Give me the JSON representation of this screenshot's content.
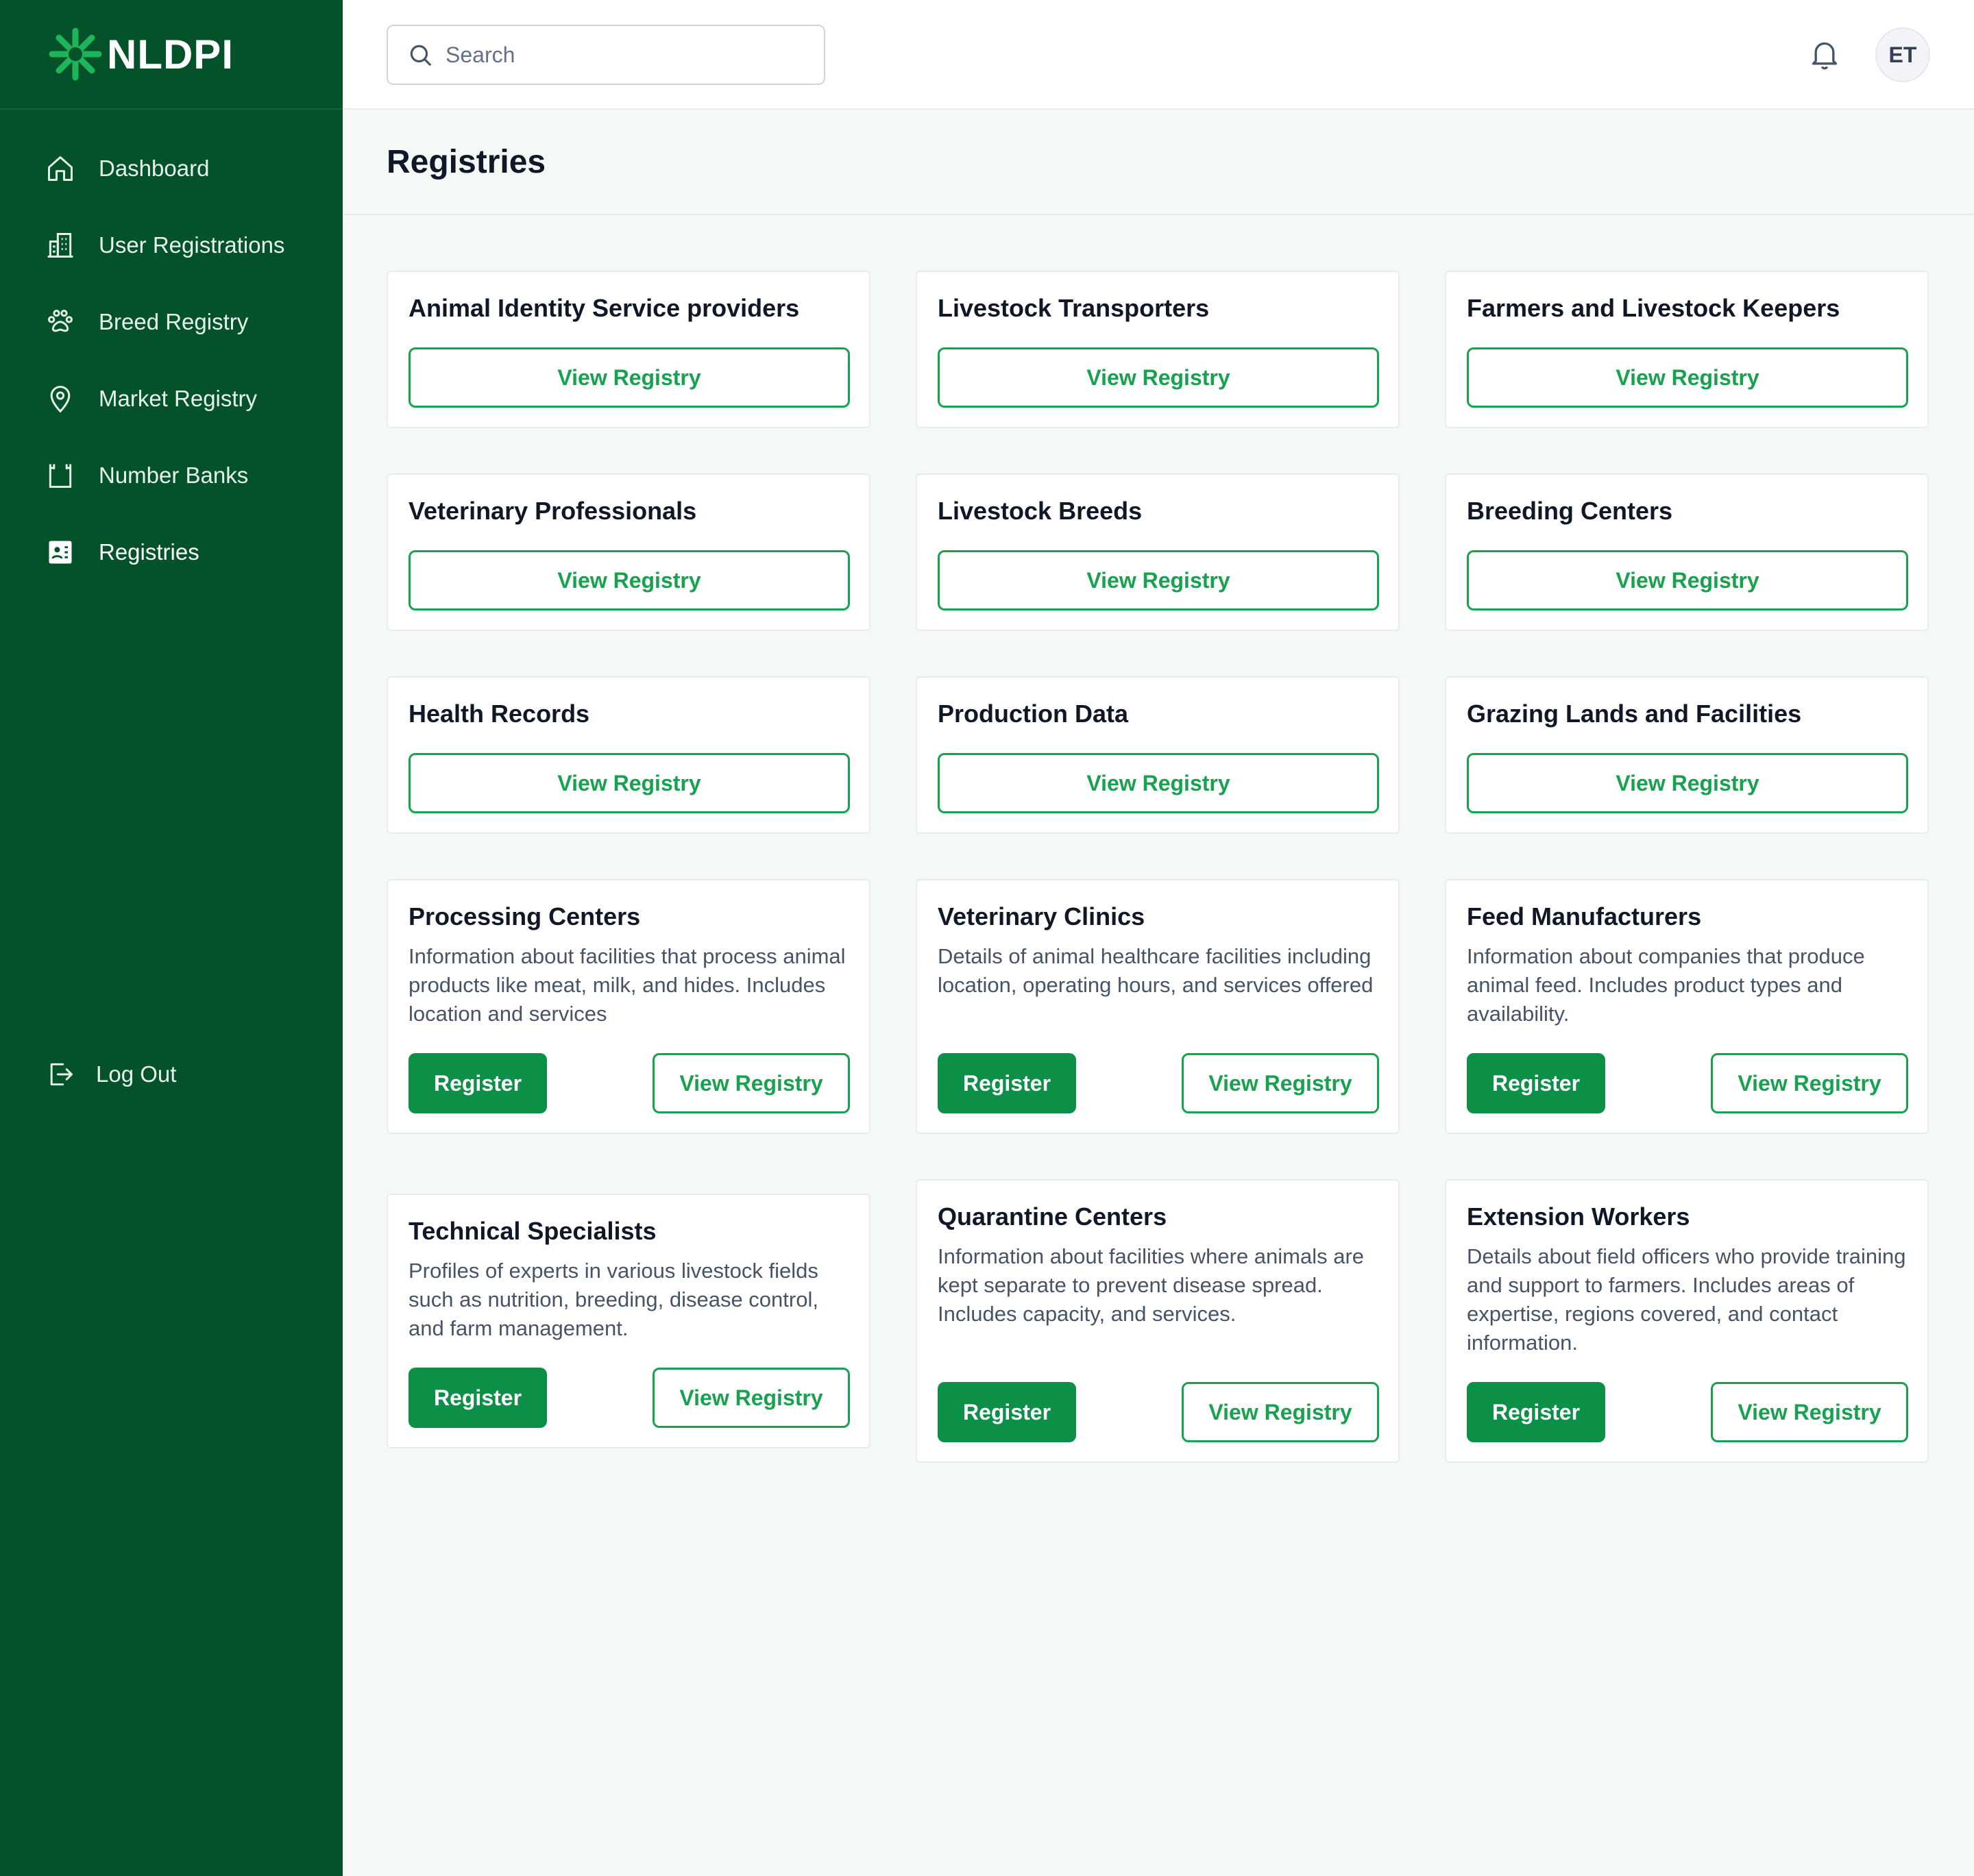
{
  "brand": {
    "name": "NLDPI"
  },
  "nav": {
    "items": [
      {
        "label": "Dashboard"
      },
      {
        "label": "User Registrations"
      },
      {
        "label": "Breed Registry"
      },
      {
        "label": "Market Registry"
      },
      {
        "label": "Number Banks"
      },
      {
        "label": "Registries"
      }
    ],
    "logout": "Log Out"
  },
  "topbar": {
    "search_placeholder": "Search",
    "avatar_initials": "ET"
  },
  "page": {
    "title": "Registries"
  },
  "colors": {
    "sidebar_bg": "#045229",
    "accent_green": "#17a24f",
    "register_button": "#0c8f47",
    "page_bg": "#f4f9f6"
  },
  "cards": [
    {
      "title": "Animal Identity Service providers",
      "view_label": "View Registry"
    },
    {
      "title": "Livestock Transporters",
      "view_label": "View Registry"
    },
    {
      "title": "Farmers and Livestock Keepers",
      "view_label": "View Registry"
    },
    {
      "title": "Veterinary Professionals",
      "view_label": "View Registry"
    },
    {
      "title": "Livestock Breeds",
      "view_label": "View Registry"
    },
    {
      "title": "Breeding Centers",
      "view_label": "View Registry"
    },
    {
      "title": "Health Records",
      "view_label": "View Registry"
    },
    {
      "title": "Production Data",
      "view_label": "View Registry"
    },
    {
      "title": "Grazing Lands and Facilities",
      "view_label": "View Registry"
    },
    {
      "title": "Processing Centers",
      "description": "Information about facilities that process animal products like meat, milk, and hides. Includes location and services",
      "register_label": "Register",
      "view_label": "View Registry"
    },
    {
      "title": "Veterinary Clinics",
      "description": "Details of animal healthcare facilities including location, operating hours, and services offered",
      "register_label": "Register",
      "view_label": "View Registry"
    },
    {
      "title": "Feed Manufacturers",
      "description": "Information about companies that produce animal feed. Includes product types and availability.",
      "register_label": "Register",
      "view_label": "View Registry"
    },
    {
      "title": "Technical Specialists",
      "description": "Profiles of experts in various livestock fields such as nutrition, breeding, disease control, and farm management.",
      "register_label": "Register",
      "view_label": "View Registry"
    },
    {
      "title": "Quarantine Centers",
      "description": "Information about facilities where animals are kept separate to prevent disease spread. Includes capacity, and services.",
      "register_label": "Register",
      "view_label": "View Registry"
    },
    {
      "title": "Extension Workers",
      "description": "Details about field officers who provide training and support to farmers. Includes areas of expertise, regions covered, and contact information.",
      "register_label": "Register",
      "view_label": "View Registry"
    }
  ]
}
